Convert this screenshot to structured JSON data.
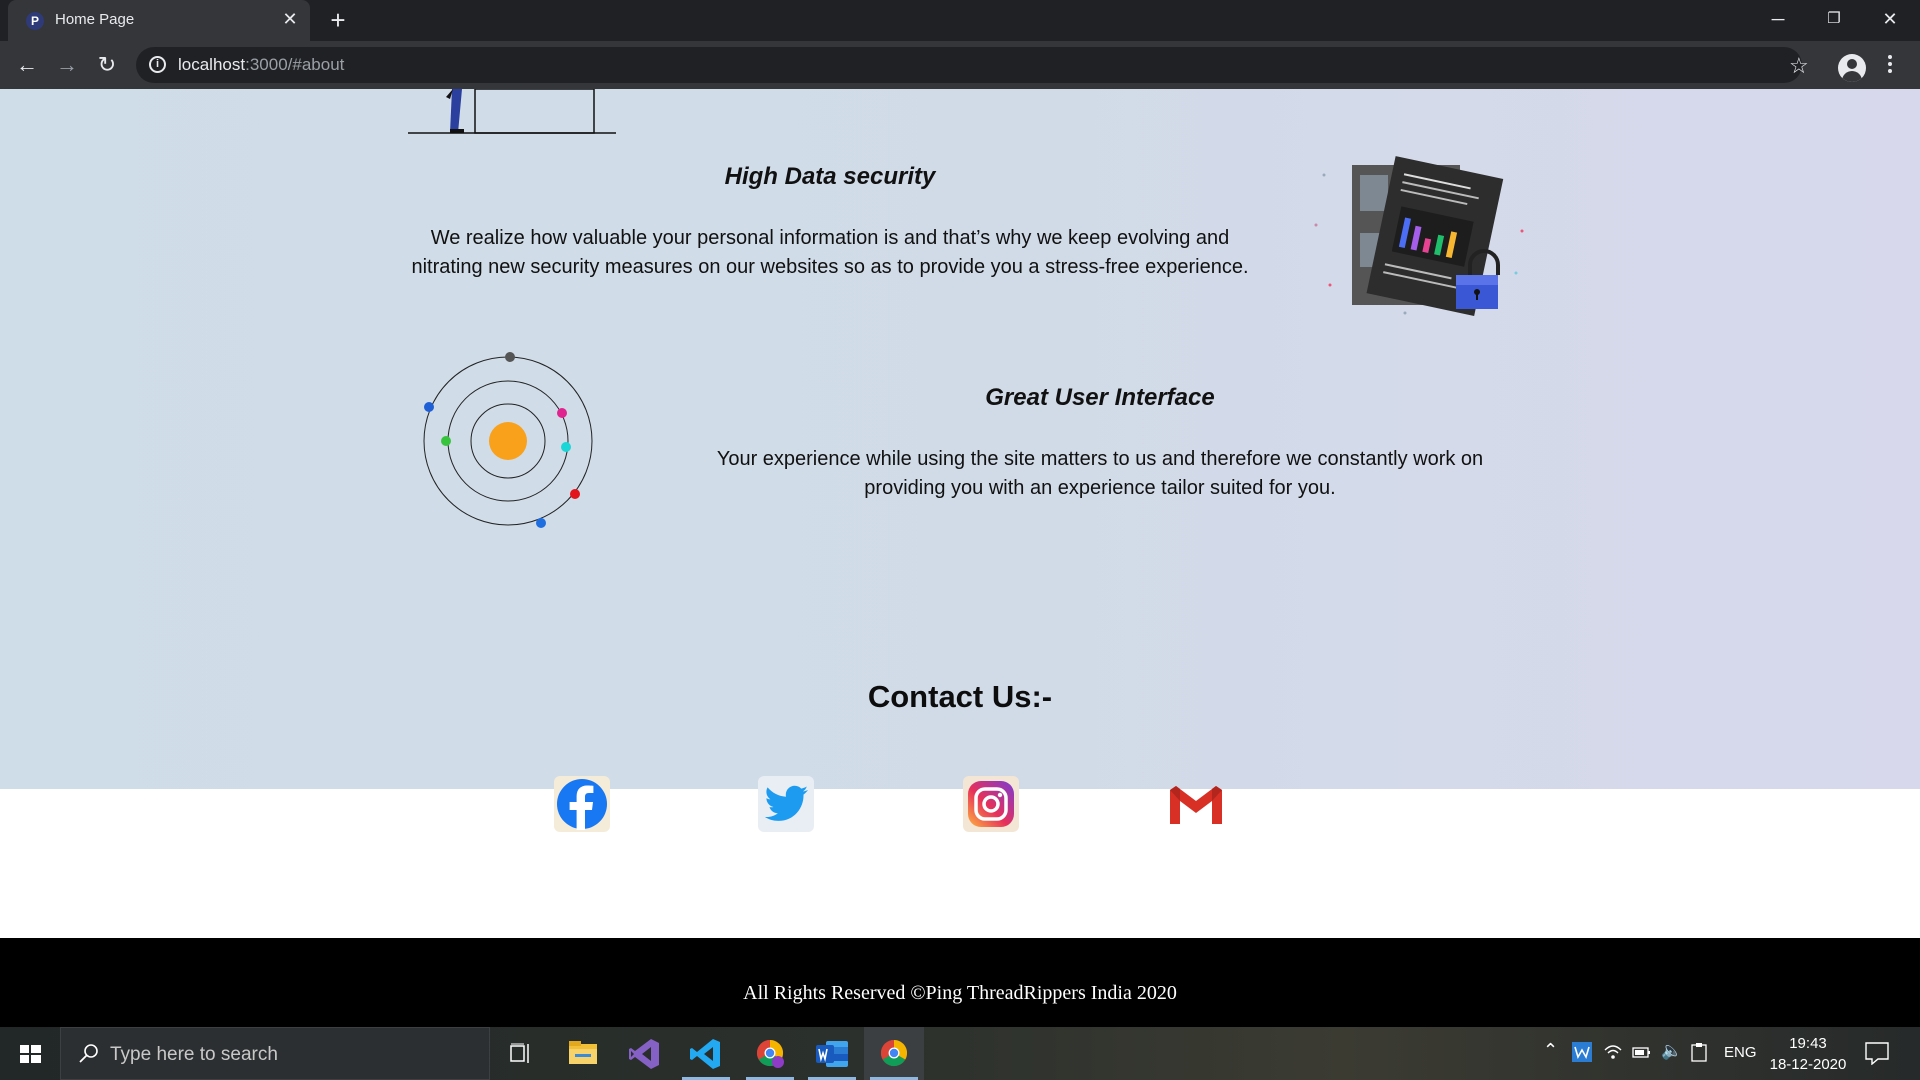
{
  "browser": {
    "tab_title": "Home Page",
    "tab_favicon_letter": "P",
    "url_host": "localhost",
    "url_rest": ":3000/#about"
  },
  "features": [
    {
      "title": "High Data security",
      "text": "We realize how valuable your personal information is and that’s why we keep evolving and nitrating new security measures on our websites so as to provide you a stress-free experience."
    },
    {
      "title": "Great User Interface",
      "text": "Your experience while using the site matters to us and therefore we constantly work on providing you with an experience tailor suited for you."
    }
  ],
  "contact": {
    "title": "Contact Us:-",
    "links": [
      {
        "icon": "facebook-icon"
      },
      {
        "icon": "twitter-icon"
      },
      {
        "icon": "instagram-icon"
      },
      {
        "icon": "gmail-icon"
      }
    ]
  },
  "footer": {
    "text": "All Rights Reserved ©Ping ThreadRippers India 2020"
  },
  "taskbar": {
    "search_placeholder": "Type here to search",
    "language": "ENG",
    "time": "19:43",
    "date": "18-12-2020"
  }
}
